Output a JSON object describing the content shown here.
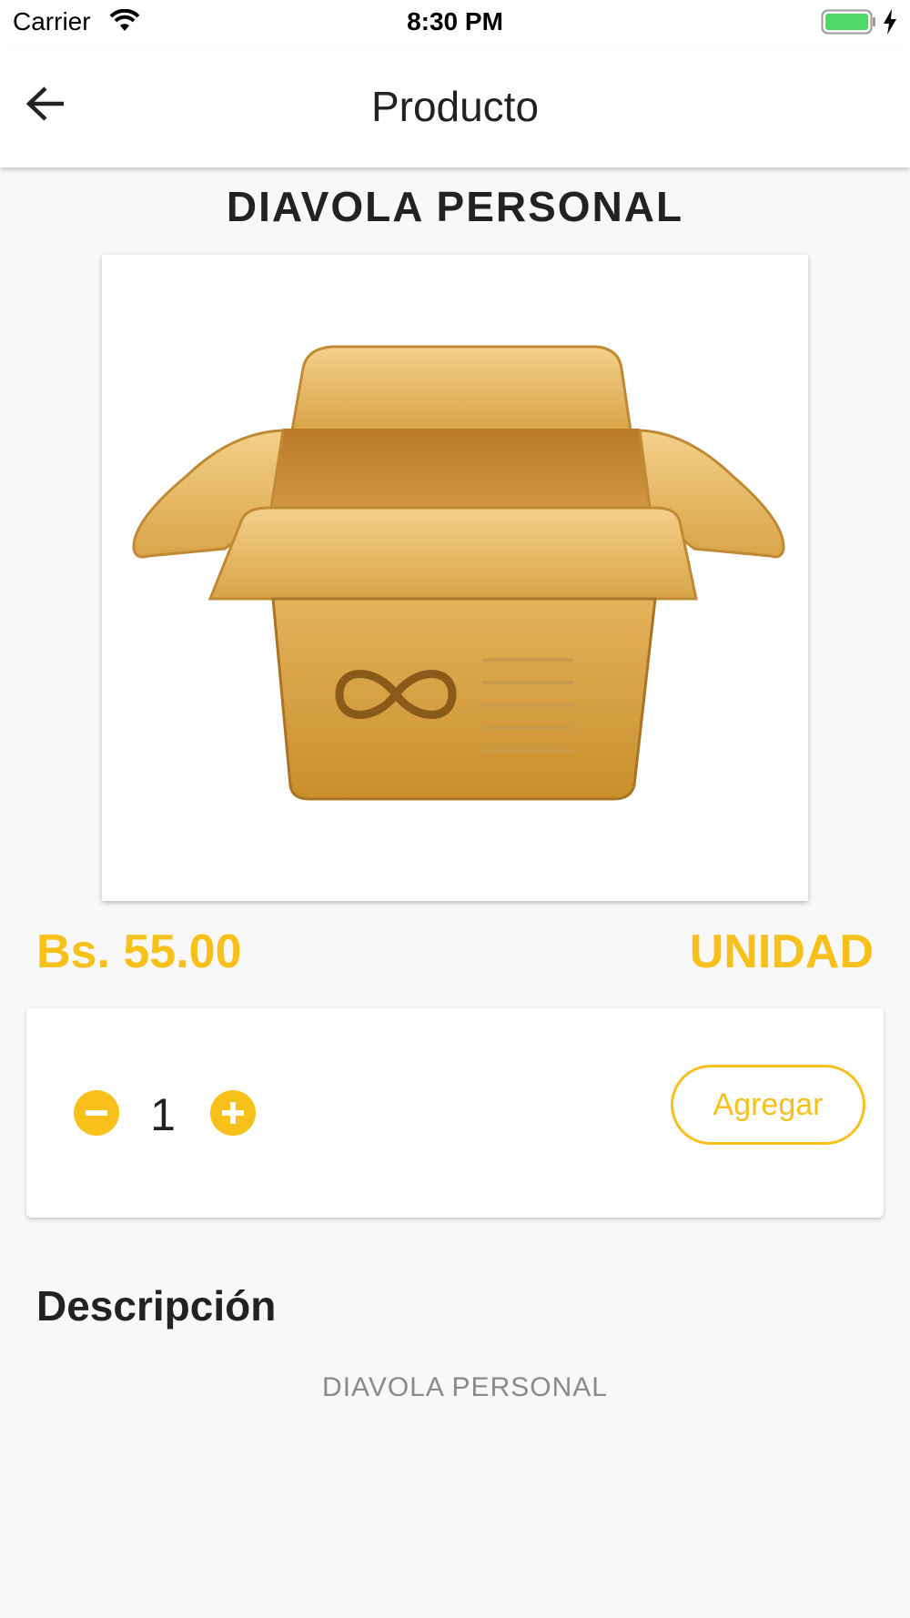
{
  "status_bar": {
    "carrier": "Carrier",
    "time": "8:30 PM",
    "icons": [
      "wifi-icon",
      "battery-icon",
      "charging-icon"
    ]
  },
  "app_bar": {
    "title": "Producto",
    "back_icon": "arrow-left-icon"
  },
  "product": {
    "name": "DIAVOLA PERSONAL",
    "image": "open-box-icon",
    "price": "Bs. 55.00",
    "unit": "UNIDAD"
  },
  "quantity": {
    "value": "1",
    "decrement_icon": "minus-circle-icon",
    "increment_icon": "plus-circle-icon",
    "add_label": "Agregar"
  },
  "description": {
    "heading": "Descripción",
    "text": "DIAVOLA PERSONAL"
  },
  "colors": {
    "accent": "#f8c01a",
    "background": "#f8f8f8",
    "card": "#ffffff",
    "battery": "#4cd964"
  }
}
